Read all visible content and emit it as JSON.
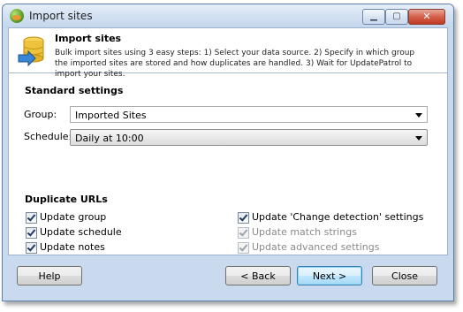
{
  "window": {
    "title": "Import sites"
  },
  "caption_buttons": {
    "minimize": "▁",
    "maximize": "▢",
    "close": "✕"
  },
  "header": {
    "title": "Import sites",
    "description": "Bulk import sites using 3 easy steps: 1) Select your data source. 2) Specify in which group the imported sites are stored and how duplicates are handled. 3) Wait for UpdatePatrol to import your sites."
  },
  "standard_settings": {
    "title": "Standard settings",
    "group_label": "Group:",
    "group_value": "Imported Sites",
    "schedule_label": "Schedule:",
    "schedule_value": "Daily at 10:00"
  },
  "duplicate_urls": {
    "title": "Duplicate URLs",
    "update_group": "Update group",
    "update_schedule": "Update schedule",
    "update_notes": "Update notes",
    "update_change_detection": "Update 'Change detection' settings",
    "update_match_strings": "Update match strings",
    "update_advanced": "Update advanced settings"
  },
  "buttons": {
    "help": "Help",
    "back": "< Back",
    "next": "Next >",
    "close": "Close"
  },
  "colors": {
    "frame": "#c9daee",
    "accent_border": "#3c7fb1"
  }
}
